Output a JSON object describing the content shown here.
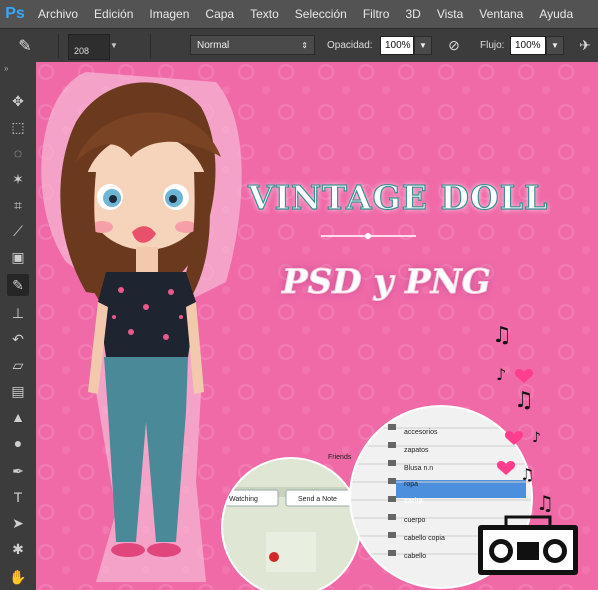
{
  "app": {
    "logo": "Ps"
  },
  "menu": [
    "Archivo",
    "Edición",
    "Imagen",
    "Capa",
    "Texto",
    "Selección",
    "Filtro",
    "3D",
    "Vista",
    "Ventana",
    "Ayuda"
  ],
  "options": {
    "brush_size": "208",
    "mode_value": "Normal",
    "opacity_label": "Opacidad:",
    "opacity_value": "100%",
    "flow_label": "Flujo:",
    "flow_value": "100%"
  },
  "tools": [
    {
      "name": "move-tool",
      "icon": "move-icon",
      "glyph": "✥"
    },
    {
      "name": "marquee-tool",
      "icon": "marquee-icon",
      "glyph": "⬚"
    },
    {
      "name": "lasso-tool",
      "icon": "lasso-icon",
      "glyph": "◌"
    },
    {
      "name": "magic-wand-tool",
      "icon": "magic-wand-icon",
      "glyph": "✶"
    },
    {
      "name": "crop-tool",
      "icon": "crop-icon",
      "glyph": "⌗"
    },
    {
      "name": "eyedropper-tool",
      "icon": "eyedropper-icon",
      "glyph": "⟋"
    },
    {
      "name": "healing-brush-tool",
      "icon": "bandage-icon",
      "glyph": "▣"
    },
    {
      "name": "brush-tool",
      "icon": "brush-icon",
      "glyph": "✎"
    },
    {
      "name": "clone-stamp-tool",
      "icon": "stamp-icon",
      "glyph": "⊥"
    },
    {
      "name": "history-brush-tool",
      "icon": "history-brush-icon",
      "glyph": "↶"
    },
    {
      "name": "eraser-tool",
      "icon": "eraser-icon",
      "glyph": "▱"
    },
    {
      "name": "gradient-tool",
      "icon": "gradient-icon",
      "glyph": "▤"
    },
    {
      "name": "blur-tool",
      "icon": "blur-icon",
      "glyph": "▲"
    },
    {
      "name": "dodge-tool",
      "icon": "dodge-icon",
      "glyph": "●"
    },
    {
      "name": "pen-tool",
      "icon": "pen-icon",
      "glyph": "✒"
    },
    {
      "name": "type-tool",
      "icon": "type-icon",
      "glyph": "T"
    },
    {
      "name": "path-selection-tool",
      "icon": "arrow-icon",
      "glyph": "➤"
    },
    {
      "name": "shape-tool",
      "icon": "shape-icon",
      "glyph": "✱"
    },
    {
      "name": "hand-tool",
      "icon": "hand-icon",
      "glyph": "✋"
    }
  ],
  "artwork": {
    "title": "VINTAGE DOLL",
    "subtitle": "PSD y PNG",
    "colors": {
      "background": "#f06aa8",
      "title_stroke": "#3b8f92",
      "heart": "#ff3f8e"
    }
  },
  "screenshot_left": {
    "label_friends": "Friends",
    "btn_watching": "Watching",
    "btn_note": "Send a Note"
  },
  "layers": [
    "accesorios",
    "zapatos",
    "Blusa n.n",
    "ropa",
    "carita",
    "cuerpo",
    "cabello copia",
    "cabello"
  ]
}
